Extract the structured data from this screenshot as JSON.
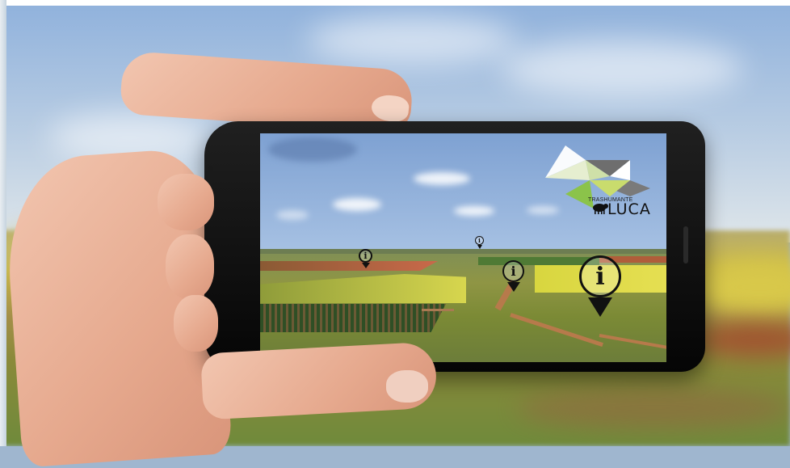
{
  "logo": {
    "line1": "TRASHUMANTE",
    "line2": "LUCA",
    "colors": [
      "#ffffff",
      "#dfe8c8",
      "#8bc34a",
      "#6b6b6b",
      "#c5d36b"
    ]
  },
  "pins": [
    {
      "icon": "info-pin-icon",
      "glyph": "i"
    },
    {
      "icon": "info-pin-icon",
      "glyph": "i"
    },
    {
      "icon": "info-pin-icon",
      "glyph": "i"
    },
    {
      "icon": "info-pin-icon",
      "glyph": "i"
    }
  ],
  "colors": {
    "phone_body": "#0b0b0b",
    "sky": "#a9c3e4",
    "field_yellow": "#d4d24a",
    "path": "#b77a4b"
  }
}
